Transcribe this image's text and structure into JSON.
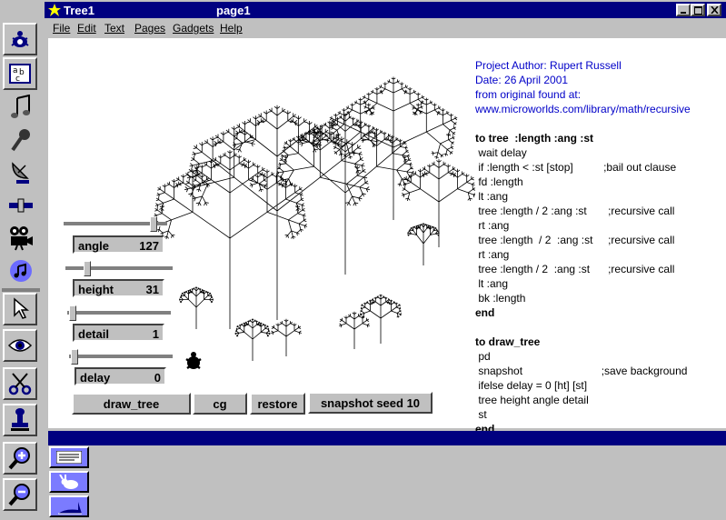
{
  "window": {
    "title": "Tree1",
    "page_name": "page1"
  },
  "menu": [
    "File",
    "Edit",
    "Text",
    "Pages",
    "Gadgets",
    "Help"
  ],
  "toolbar": {
    "top_icons": [
      "turtle-icon",
      "text-box-icon",
      "music-note-icon",
      "microphone-icon",
      "satellite-dish-icon",
      "slider-icon",
      "movie-camera-icon",
      "cd-music-icon"
    ],
    "bottom_icons": [
      "pointer-icon",
      "eye-icon",
      "scissors-icon",
      "stamp-icon",
      "zoom-in-icon",
      "zoom-out-icon"
    ]
  },
  "sliders": [
    {
      "label": "angle",
      "value": "127",
      "position": 0.9
    },
    {
      "label": "height",
      "value": "31",
      "position": 0.18
    },
    {
      "label": "detail",
      "value": "1",
      "position": 0.02
    },
    {
      "label": "delay",
      "value": "0",
      "position": 0.02
    }
  ],
  "buttons": {
    "draw_tree": "draw_tree",
    "cg": "cg",
    "restore": "restore",
    "snapshot": "snapshot seed 10"
  },
  "info": {
    "author": "Project Author: Rupert Russell",
    "date": "Date: 26 April 2001",
    "found": "from original found at:",
    "url": "www.microworlds.com/library/math/recursive"
  },
  "code_tree": {
    "header": "to tree  :length :ang :st",
    "lines": [
      " wait delay",
      " if :length < :st [stop]          ;bail out clause",
      " fd :length",
      " lt :ang",
      " tree :length / 2 :ang :st       ;recursive call",
      " rt :ang",
      " tree :length  / 2  :ang :st     ;recursive call",
      " rt :ang",
      " tree :length / 2  :ang :st      ;recursive call",
      " lt :ang",
      " bk :length"
    ],
    "end": "end"
  },
  "code_draw": {
    "header": "to draw_tree",
    "lines": [
      " pd",
      " snapshot                          ;save background",
      " ifelse delay = 0 [ht] [st]",
      " tree height angle detail",
      " st"
    ],
    "end": "end"
  },
  "colors": {
    "title_bar": "#000080",
    "info_text": "#0000c8",
    "page_button": "#7b7bff"
  },
  "page_buttons": [
    "text-page-icon",
    "rabbit-icon",
    "shape-icon"
  ]
}
